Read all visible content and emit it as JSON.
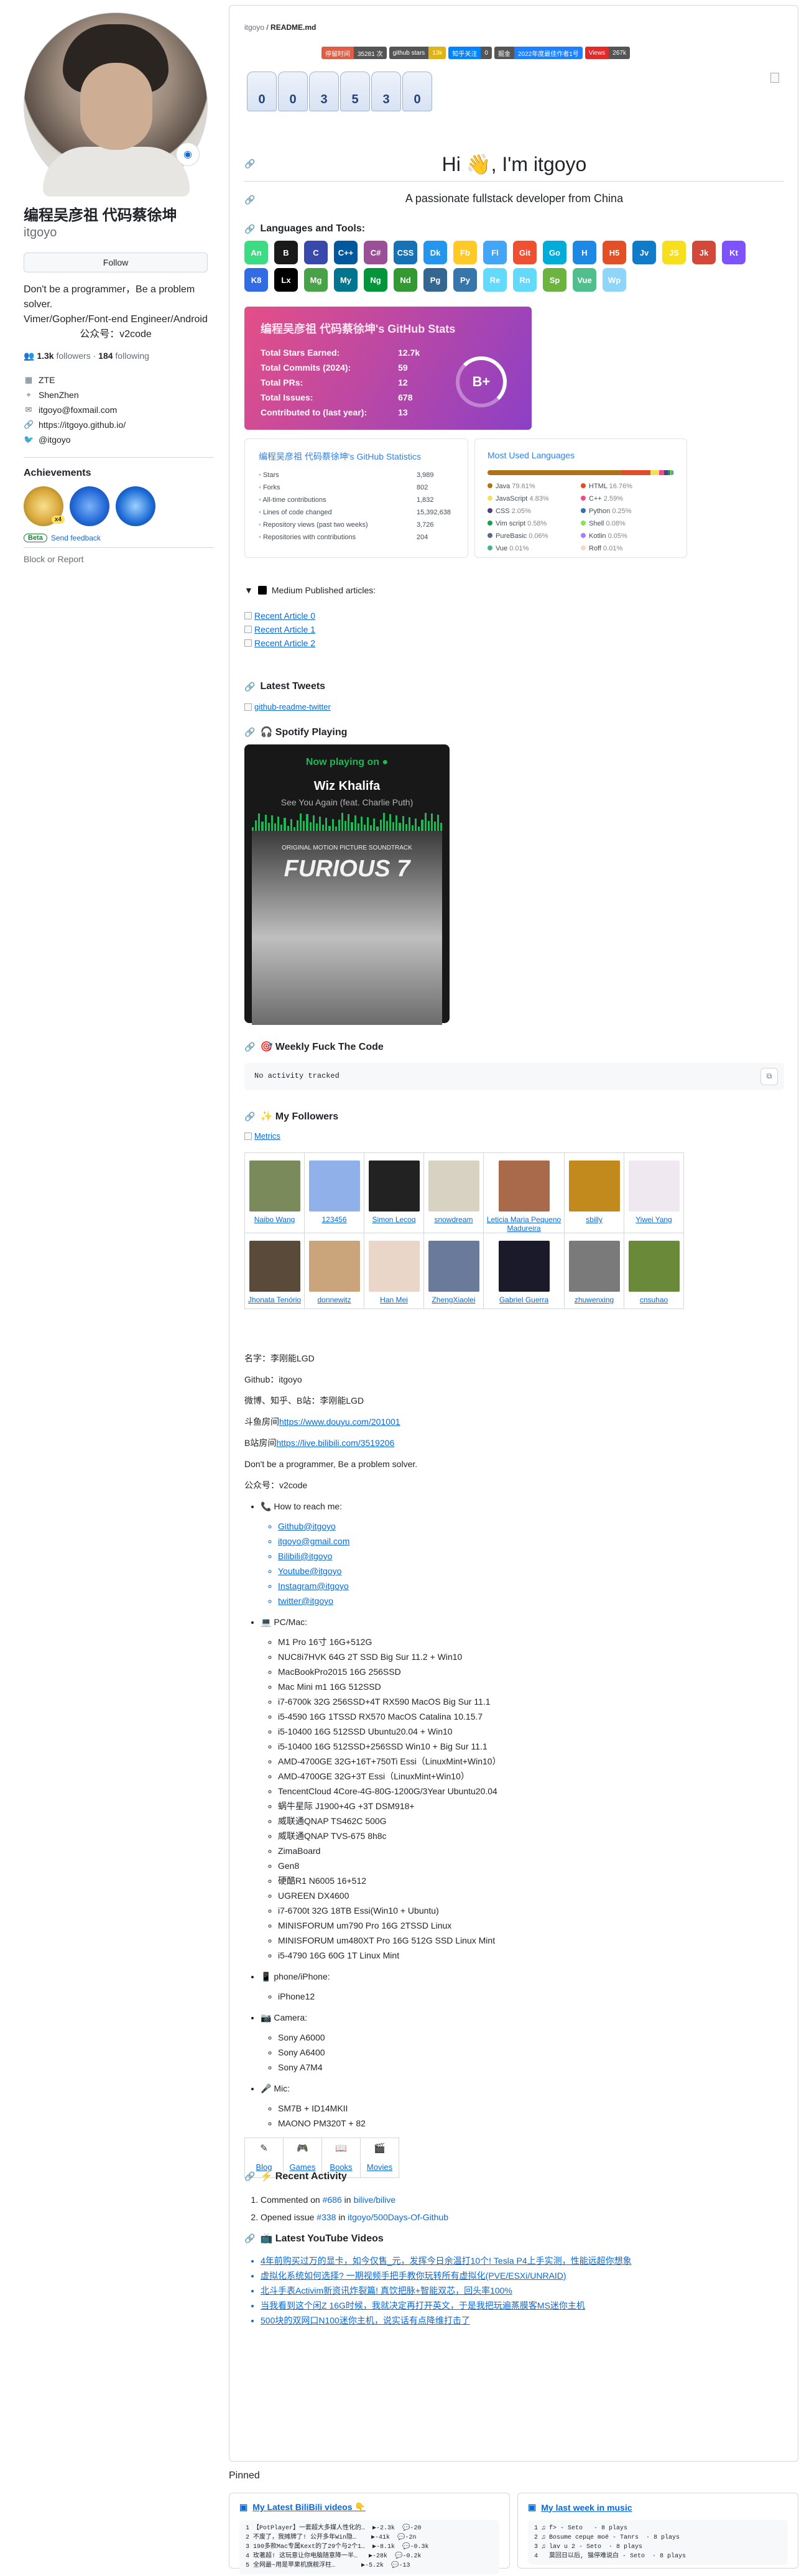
{
  "profile": {
    "name": "编程吴彦祖 代码蔡徐坤",
    "login": "itgoyo",
    "follow_label": "Follow",
    "bio_line1": "Don't be a programmer，Be a problem solver.",
    "bio_line2": "Vimer/Gopher/Font-end Engineer/Android",
    "bio_line3": "公众号：v2code",
    "followers_count": "1.3k",
    "followers_label": "followers",
    "following_count": "184",
    "following_label": "following",
    "company": "ZTE",
    "location": "ShenZhen",
    "email": "itgoyo@foxmail.com",
    "website": "https://itgoyo.github.io/",
    "twitter": "@itgoyo",
    "achievements_title": "Achievements",
    "achievement_multiplier": "x4",
    "beta_label": "Beta",
    "send_feedback": "Send feedback",
    "block_report": "Block or Report"
  },
  "readme": {
    "path_user": "itgoyo",
    "path_file": "README.md",
    "shields": [
      {
        "l": "停留时间",
        "r": "35281 次",
        "lc": "#e05d44",
        "rc": "#555"
      },
      {
        "l": "github stars",
        "r": "13k",
        "lc": "#555",
        "rc": "#dfb317"
      },
      {
        "l": "知乎关注",
        "r": "0",
        "lc": "#0084ff",
        "rc": "#555"
      },
      {
        "l": "掘金",
        "r": "2022年度最佳作者1号",
        "lc": "#555",
        "rc": "#1e80ff"
      },
      {
        "l": "Views",
        "r": "267k",
        "lc": "#e12a2a",
        "rc": "#555"
      }
    ],
    "counter_digits": [
      "0",
      "0",
      "3",
      "5",
      "3",
      "0"
    ],
    "greeting": "Hi 👋, I'm itgoyo",
    "tagline": "A passionate fullstack developer from China",
    "languages_heading": "Languages and Tools:",
    "tools": [
      {
        "t": "An",
        "c": "#3ddc84"
      },
      {
        "t": "B",
        "c": "#1a1a1a"
      },
      {
        "t": "C",
        "c": "#3949ab"
      },
      {
        "t": "C++",
        "c": "#00599c"
      },
      {
        "t": "C#",
        "c": "#9b4f96"
      },
      {
        "t": "CSS",
        "c": "#1572b6"
      },
      {
        "t": "Dk",
        "c": "#2496ed"
      },
      {
        "t": "Fb",
        "c": "#ffca28"
      },
      {
        "t": "Fl",
        "c": "#42a5f5"
      },
      {
        "t": "Git",
        "c": "#f05032"
      },
      {
        "t": "Go",
        "c": "#00add8"
      },
      {
        "t": "H",
        "c": "#1e88e5"
      },
      {
        "t": "H5",
        "c": "#e34f26"
      },
      {
        "t": "Jv",
        "c": "#0e7bcb"
      },
      {
        "t": "JS",
        "c": "#f7df1e"
      },
      {
        "t": "Jk",
        "c": "#d24939"
      },
      {
        "t": "Kt",
        "c": "#7f52ff"
      },
      {
        "t": "K8",
        "c": "#326ce5"
      },
      {
        "t": "Lx",
        "c": "#000"
      },
      {
        "t": "Mg",
        "c": "#47a248"
      },
      {
        "t": "My",
        "c": "#00758f"
      },
      {
        "t": "Ng",
        "c": "#009639"
      },
      {
        "t": "Nd",
        "c": "#339933"
      },
      {
        "t": "Pg",
        "c": "#336791"
      },
      {
        "t": "Py",
        "c": "#3776ab"
      },
      {
        "t": "Re",
        "c": "#61dafb"
      },
      {
        "t": "Rn",
        "c": "#61dafb"
      },
      {
        "t": "Sp",
        "c": "#6db33f"
      },
      {
        "t": "Vue",
        "c": "#4fc08d"
      },
      {
        "t": "Wp",
        "c": "#8dd6f9"
      }
    ],
    "stats_title": "编程吴彦祖 代码蔡徐坤's GitHub Stats",
    "stats_rows": [
      {
        "k": "Total Stars Earned:",
        "v": "12.7k"
      },
      {
        "k": "Total Commits (2024):",
        "v": "59"
      },
      {
        "k": "Total PRs:",
        "v": "12"
      },
      {
        "k": "Total Issues:",
        "v": "678"
      },
      {
        "k": "Contributed to (last year):",
        "v": "13"
      }
    ],
    "grade": "B+",
    "stats2_title": "编程吴彦祖 代码蔡徐坤's GitHub Statistics",
    "stats2_rows": [
      {
        "k": "Stars",
        "v": "3,989"
      },
      {
        "k": "Forks",
        "v": "802"
      },
      {
        "k": "All-time contributions",
        "v": "1,832"
      },
      {
        "k": "Lines of code changed",
        "v": "15,392,638"
      },
      {
        "k": "Repository views (past two weeks)",
        "v": "3,726"
      },
      {
        "k": "Repositories with contributions",
        "v": "204"
      }
    ],
    "langs_title": "Most Used Languages",
    "langs": [
      {
        "n": "Java",
        "p": "79.61%",
        "c": "#b07219",
        "w": 79.61
      },
      {
        "n": "HTML",
        "p": "16.76%",
        "c": "#e34c26",
        "w": 16.76
      },
      {
        "n": "JavaScript",
        "p": "4.83%",
        "c": "#f1e05a",
        "w": 4.83
      },
      {
        "n": "C++",
        "p": "2.59%",
        "c": "#f34b7d",
        "w": 2.59
      },
      {
        "n": "CSS",
        "p": "2.05%",
        "c": "#563d7c",
        "w": 2.05
      },
      {
        "n": "Python",
        "p": "0.25%",
        "c": "#3572a5",
        "w": 0.25
      },
      {
        "n": "Vim script",
        "p": "0.58%",
        "c": "#199f4b",
        "w": 0.58
      },
      {
        "n": "Shell",
        "p": "0.08%",
        "c": "#89e051",
        "w": 0.08
      },
      {
        "n": "PureBasic",
        "p": "0.06%",
        "c": "#5a6986",
        "w": 0.06
      },
      {
        "n": "Kotlin",
        "p": "0.05%",
        "c": "#a97bff",
        "w": 0.05
      },
      {
        "n": "Vue",
        "p": "0.01%",
        "c": "#41b883",
        "w": 0.01
      },
      {
        "n": "Roff",
        "p": "0.01%",
        "c": "#ecdebe",
        "w": 0.01
      }
    ],
    "medium_heading": "Medium Published articles:",
    "medium_links": [
      "Recent Article 0",
      "Recent Article 1",
      "Recent Article 2"
    ],
    "tweets_heading": "Latest Tweets",
    "tweets_link": "github-readme-twitter",
    "spotify_heading": "🎧 Spotify Playing",
    "spotify_now": "Now playing on",
    "spotify_artist": "Wiz Khalifa",
    "spotify_song": "See You Again (feat. Charlie Puth)",
    "spotify_ost": "ORIGINAL MOTION PICTURE SOUNDTRACK",
    "spotify_album": "FURIOUS 7",
    "weekly_heading": "🎯 Weekly Fuck The Code",
    "weekly_code": "No activity tracked",
    "followers_heading": "✨ My Followers",
    "metrics_link": "Metrics",
    "followers": [
      {
        "n": "Naibo Wang",
        "c": "#7a8a5a"
      },
      {
        "n": "123456",
        "c": "#8fb0e8"
      },
      {
        "n": "Simon Lecoq",
        "c": "#222"
      },
      {
        "n": "snowdream",
        "c": "#d8d2c2"
      },
      {
        "n": "Leticia Maria Pequeno Madureira",
        "c": "#a86a4a"
      },
      {
        "n": "sbilly",
        "c": "#c28a1c"
      },
      {
        "n": "Yiwei Yang",
        "c": "#f0e8f0"
      },
      {
        "n": "Jhonata Tenório",
        "c": "#5a4a3a"
      },
      {
        "n": "donnewitz",
        "c": "#caa47a"
      },
      {
        "n": "Han Mei",
        "c": "#e9d6c8"
      },
      {
        "n": "ZhengXiaolei",
        "c": "#6a7a9a"
      },
      {
        "n": "Gabriel Guerra",
        "c": "#1a1a2a"
      },
      {
        "n": "zhuwenxing",
        "c": "#7a7a7a"
      },
      {
        "n": "cnsuhao",
        "c": "#6a8a3a"
      }
    ],
    "about_name": "名字：李刚能LGD",
    "about_github": "Github：itgoyo",
    "about_social": "微博、知乎、B站：李刚能LGD",
    "about_douyu_label": "斗鱼房间",
    "about_douyu_url": "https://www.douyu.com/201001",
    "about_bili_label": "B站房间",
    "about_bili_url": "https://live.bilibili.com/3519206",
    "about_motto": "Don't be a programmer, Be a problem solver.",
    "about_wechat": "公众号：v2code",
    "reach_label": "How to reach me:",
    "reach": [
      "Github@itgoyo",
      "itgoyo@gmail.com",
      "Bilibili@itgoyo",
      "Youtube@itgoyo",
      "Instagram@itgoyo",
      "twitter@itgoyo"
    ],
    "pc_label": "PC/Mac:",
    "pcs": [
      "M1 Pro 16寸 16G+512G",
      "NUC8i7HVK 64G 2T SSD Big Sur 11.2 + Win10",
      "MacBookPro2015 16G 256SSD",
      "Mac Mini m1 16G 512SSD",
      "i7-6700k 32G 256SSD+4T RX590 MacOS Big Sur 11.1",
      "i5-4590 16G 1TSSD RX570 MacOS Catalina 10.15.7",
      "i5-10400 16G 512SSD Ubuntu20.04 + Win10",
      "i5-10400 16G 512SSD+256SSD Win10 + Big Sur 11.1",
      "AMD-4700GE 32G+16T+750Ti Essi（LinuxMint+Win10）",
      "AMD-4700GE 32G+3T Essi（LinuxMint+Win10）",
      "TencentCloud 4Core-4G-80G-1200G/3Year Ubuntu20.04",
      "蜗牛星际 J1900+4G +3T DSM918+",
      "威联通QNAP TS462C 500G",
      "威联通QNAP TVS-675 8h8c",
      "ZimaBoard",
      "Gen8",
      "硬酷R1 N6005 16+512",
      "UGREEN DX4600",
      "i7-6700t 32G 18TB Essi(Win10 + Ubuntu)",
      "MINISFORUM um790 Pro 16G 2TSSD Linux",
      "MINISFORUM um480XT Pro 16G 512G SSD Linux Mint",
      "i5-4790 16G 60G 1T Linux Mint"
    ],
    "phone_label": "phone/iPhone:",
    "phones": [
      "iPhone12"
    ],
    "camera_label": "Camera:",
    "cameras": [
      "Sony A6000",
      "Sony A6400",
      "Sony A7M4"
    ],
    "mic_label": "Mic:",
    "mics": [
      "SM7B + ID14MKII",
      "MAONO PM320T + 82"
    ],
    "nav": [
      {
        "e": "✎",
        "l": "Blog"
      },
      {
        "e": "🎮",
        "l": "Games"
      },
      {
        "e": "📖",
        "l": "Books"
      },
      {
        "e": "🎬",
        "l": "Movies"
      }
    ],
    "recent_heading": "⚡ Recent Activity",
    "recent": [
      {
        "pre": "Commented on ",
        "num": "#686",
        "mid": " in ",
        "repo": "bilive/bilive"
      },
      {
        "pre": "Opened issue ",
        "num": "#338",
        "mid": " in ",
        "repo": "itgoyo/500Days-Of-Github"
      }
    ],
    "youtube_heading": "📺 Latest YouTube Videos",
    "youtube": [
      "4年前购买过万的显卡，如今仅售_元，发挥今日余温打10个! Tesla P4上手实测，性能远超你想象",
      "虚拟化系统如何选择? 一期视频手把手教你玩转所有虚拟化(PVE/ESXi/UNRAID)",
      "北斗手表Activim新资讯炸裂篇! 真饮把脉+智能双芯，回头率100%",
      "当我看到这个闲Z 16G时候，我就决定再打开英文，于是我把玩遍蒸膜客MS迷你主机",
      "500块的双网口N100迷你主机，说实话有点降维打击了"
    ]
  },
  "pinned": {
    "title": "Pinned",
    "bili_title": "My Latest BiliBili videos 👇",
    "bili_code": "1 【PotPlayer】一套超大多媒人性化的…  ▶-2.3k  💬-20\n2 不废了，我摊牌了! 公开多年Win隐…    ▶-41k  💬-2n\n3 190多款Mac专属Kext的了29个与2个1…  ▶-8.1k  💬-0.3k\n4 玫著超! 这玩意让你电脑随意降一半…   ▶-28k  💬-0.2k\n5 全网最~用是苹果机旗舰浮柱…       ▶-5.2k  💬-13",
    "music_title": "My last week in music",
    "music_code": "1 ♫ f> - Seto   · 8 plays\n2 ♫ Bosume серце moё - Tanrs  · 8 plays\n3 ♫ lav u 2 - Seto  · 8 plays\n4   莫回日以后, 猫停难说白 - Seto  · 8 plays"
  }
}
